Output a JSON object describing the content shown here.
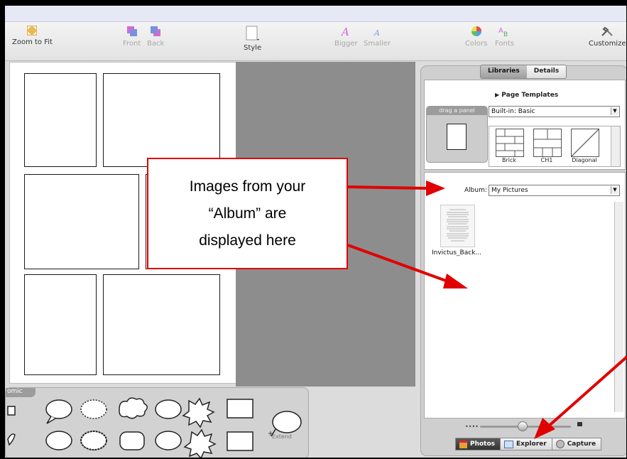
{
  "toolbar": {
    "zoom_label": "Zoom to Fit",
    "front_label": "Front",
    "back_label": "Back",
    "style_label": "Style",
    "bigger_label": "Bigger",
    "smaller_label": "Smaller",
    "colors_label": "Colors",
    "fonts_label": "Fonts",
    "customize_label": "Customize"
  },
  "tray": {
    "label": "omic",
    "extend_label": "Extend"
  },
  "right_panel": {
    "tabs": [
      "Libraries",
      "Details"
    ],
    "active_tab": "Libraries",
    "page_templates_label": "Page Templates",
    "drag_panel_label": "drag a panel",
    "template_select_value": "Built-in: Basic",
    "templates": [
      "Brick",
      "CH1",
      "Diagonal"
    ],
    "album_label": "Album:",
    "album_select_value": "My Pictures",
    "album_items": [
      {
        "name": "Invictus_Back..."
      }
    ],
    "bottom_tabs": [
      "Photos",
      "Explorer",
      "Capture"
    ],
    "active_bottom_tab": "Photos"
  },
  "callout": {
    "line1": "Images from your",
    "line2": "“Album” are",
    "line3": "displayed here"
  },
  "colors": {
    "annotation_red": "#e00000",
    "canvas_gray": "#8d8d8d"
  }
}
